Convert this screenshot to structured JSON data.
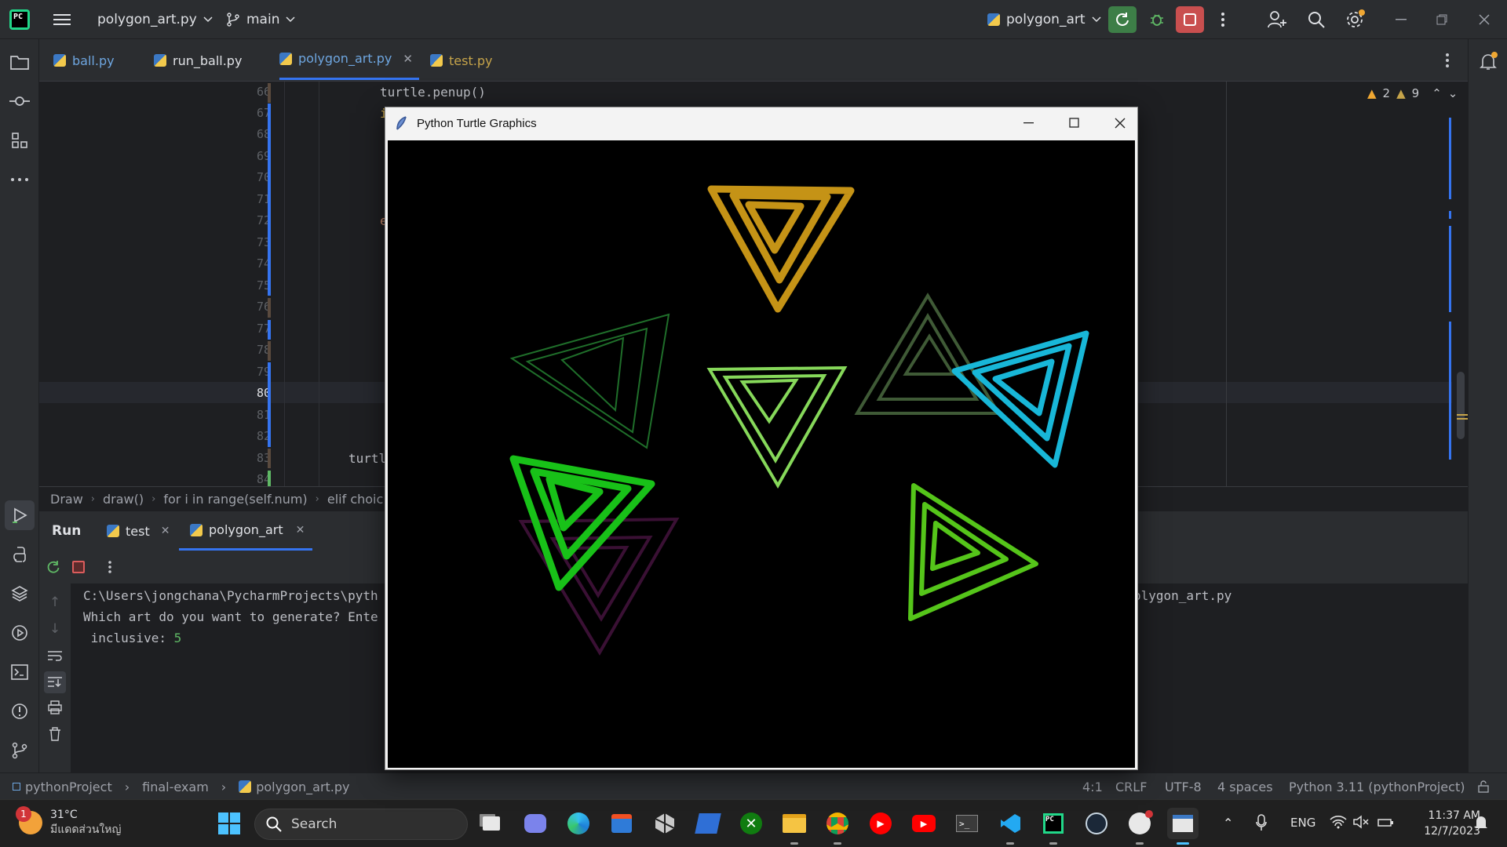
{
  "titlebar": {
    "project_name": "polygon_art.py",
    "branch": "main",
    "run_config": "polygon_art"
  },
  "editor_tabs": [
    {
      "label": "ball.py",
      "color": "#6ea6e0"
    },
    {
      "label": "run_ball.py",
      "color": "#dfe1e5"
    },
    {
      "label": "polygon_art.py",
      "color": "#6ea6e0"
    },
    {
      "label": "test.py",
      "color": "#c6a44a"
    }
  ],
  "inspections": {
    "warnings_a": "2",
    "warnings_b": "9"
  },
  "code_lines": [
    {
      "num": "66",
      "text": "turtle.penup()"
    },
    {
      "num": "67",
      "text": "i"
    },
    {
      "num": "68",
      "text": ""
    },
    {
      "num": "69",
      "text": ""
    },
    {
      "num": "70",
      "text": ""
    },
    {
      "num": "71",
      "text": ""
    },
    {
      "num": "72",
      "text": "e"
    },
    {
      "num": "73",
      "text": ""
    },
    {
      "num": "74",
      "text": ""
    },
    {
      "num": "75",
      "text": ""
    },
    {
      "num": "76",
      "text": ""
    },
    {
      "num": "77",
      "text": ""
    },
    {
      "num": "78",
      "text": ""
    },
    {
      "num": "79",
      "text": ""
    },
    {
      "num": "80",
      "text": ""
    },
    {
      "num": "81",
      "text": ""
    },
    {
      "num": "82",
      "text": ""
    },
    {
      "num": "83",
      "text": "turtl"
    },
    {
      "num": "84",
      "text": ""
    }
  ],
  "breadcrumb": [
    "Draw",
    "draw()",
    "for i in range(self.num)",
    "elif choic"
  ],
  "run_panel": {
    "title": "Run",
    "tabs": [
      {
        "label": "test"
      },
      {
        "label": "polygon_art"
      }
    ]
  },
  "console": {
    "line1": "C:\\Users\\jongchana\\PycharmProjects\\pyth",
    "line1_tail": "olygon_art.py",
    "line2": "Which art do you want to generate? Ente",
    "line3_label": " inclusive: ",
    "line3_value": "5"
  },
  "statusbar": {
    "breadcrumb": [
      "pythonProject",
      "final-exam",
      "polygon_art.py"
    ],
    "position": "4:1",
    "line_sep": "CRLF",
    "encoding": "UTF-8",
    "indent": "4 spaces",
    "interpreter": "Python 3.11 (pythonProject)"
  },
  "turtle_window": {
    "title": "Python Turtle Graphics"
  },
  "taskbar": {
    "weather_temp": "31°C",
    "weather_desc": "มีแดดส่วนใหญ่",
    "weather_badge": "1",
    "search_placeholder": "Search",
    "lang": "ENG",
    "time": "11:37 AM",
    "date": "12/7/2023"
  }
}
